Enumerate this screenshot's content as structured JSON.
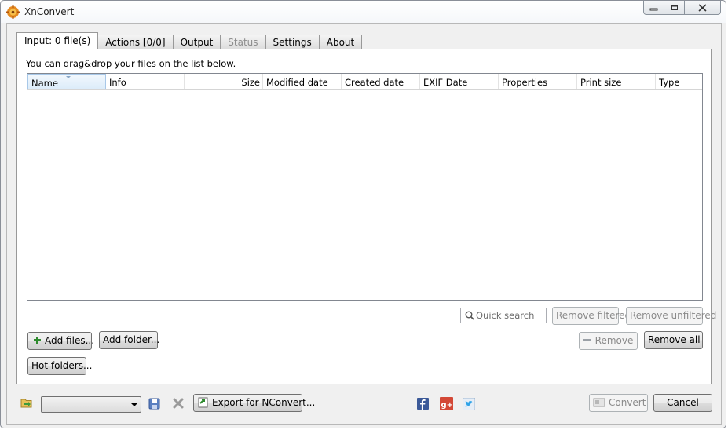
{
  "window": {
    "title": "XnConvert"
  },
  "tabs": [
    {
      "label": "Input: 0 file(s)",
      "active": true
    },
    {
      "label": "Actions [0/0]"
    },
    {
      "label": "Output"
    },
    {
      "label": "Status",
      "disabled": true
    },
    {
      "label": "Settings"
    },
    {
      "label": "About"
    }
  ],
  "input": {
    "hint": "You can drag&drop your files on the list below.",
    "columns": [
      "Name",
      "Info",
      "Size",
      "Modified date",
      "Created date",
      "EXIF Date",
      "Properties",
      "Print size",
      "Type"
    ],
    "search_placeholder": "Quick search",
    "remove_filtered": "Remove filtered",
    "remove_unfiltered": "Remove unfiltered",
    "add_files": "Add files...",
    "add_folder": "Add folder...",
    "remove": "Remove",
    "remove_all": "Remove all",
    "hot_folders": "Hot folders..."
  },
  "footer": {
    "preset_value": "",
    "export_label": "Export for NConvert...",
    "convert": "Convert",
    "cancel": "Cancel"
  },
  "icons": {
    "app": "xnconvert-logo-icon",
    "open_folder": "open-folder-icon",
    "save": "save-icon",
    "delete": "delete-icon",
    "export": "export-icon",
    "facebook": "facebook-icon",
    "googleplus": "google-plus-icon",
    "twitter": "twitter-icon"
  },
  "colors": {
    "accent": "#3b5998",
    "gplus": "#d34836",
    "twitter": "#2ea3e8"
  }
}
